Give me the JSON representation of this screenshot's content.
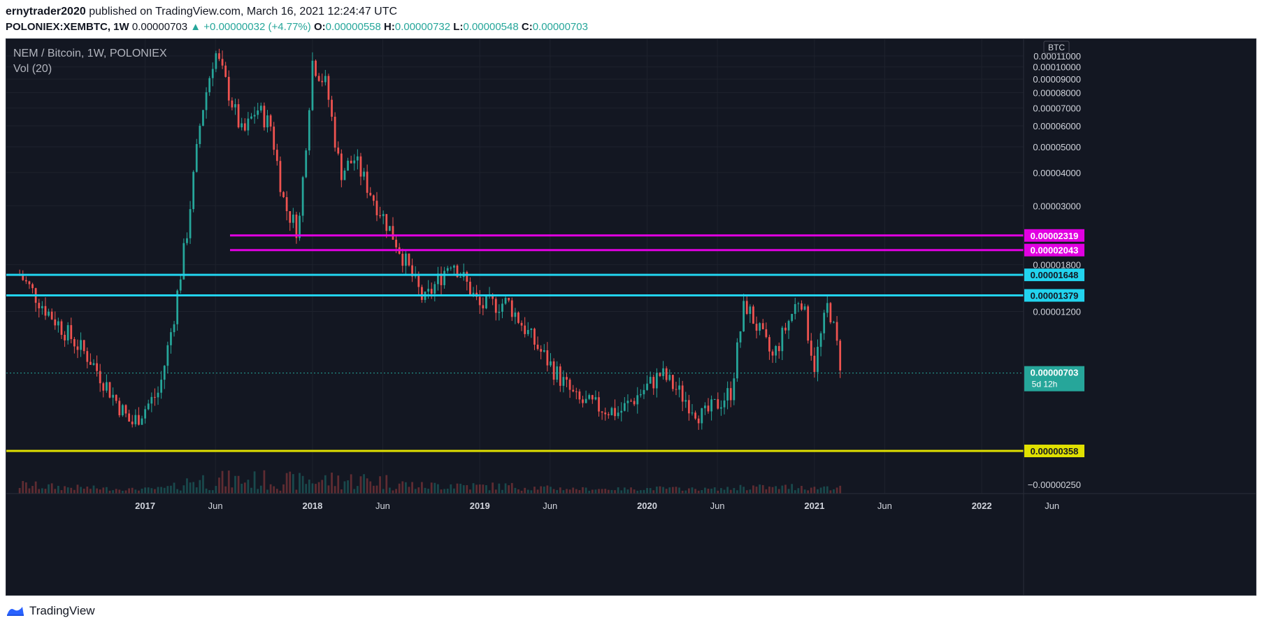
{
  "header": {
    "author": "ernytrader2020",
    "published": "published on TradingView.com, March 16, 2021 12:24:47 UTC"
  },
  "symbol_line": {
    "symbol": "POLONIEX:XEMBTC, 1W",
    "price": "0.00000703",
    "change": "▲ +0.00000032 (+4.77%)",
    "o_label": "O:",
    "o_value": "0.00000558",
    "h_label": "H:",
    "h_value": "0.00000732",
    "l_label": "L:",
    "l_value": "0.00000548",
    "c_label": "C:",
    "c_value": "0.00000703"
  },
  "legend": {
    "title": "NEM / Bitcoin, 1W, POLONIEX",
    "indicator": "Vol (20)"
  },
  "footer": {
    "brand": "TradingView",
    "logo_icon": "tradingview-logo-icon"
  },
  "colors": {
    "background": "#131722",
    "up": "#26a69a",
    "down": "#ef5350",
    "magenta": "#e100e1",
    "cyan": "#22d3ee",
    "yellow": "#e0e000",
    "grid": "#1e222d",
    "axis_text": "#d1d4dc"
  },
  "chart_data": {
    "type": "candlestick",
    "currency_badge": "BTC",
    "y_ticks": [
      "0.00011000",
      "0.00010000",
      "0.00009000",
      "0.00008000",
      "0.00007000",
      "0.00006000",
      "0.00005000",
      "0.00004000",
      "0.00003000",
      "0.00001800",
      "0.00001200",
      "−0.00000250"
    ],
    "x_ticks": [
      "2017",
      "Jun",
      "2018",
      "Jun",
      "2019",
      "Jun",
      "2020",
      "Jun",
      "2021",
      "Jun",
      "2022",
      "Jun"
    ],
    "horizontal_levels": [
      {
        "label": "0.00002319",
        "value": 2.319e-05,
        "color": "#e100e1"
      },
      {
        "label": "0.00002043",
        "value": 2.043e-05,
        "color": "#e100e1"
      },
      {
        "label": "0.00001648",
        "value": 1.648e-05,
        "color": "#22d3ee"
      },
      {
        "label": "0.00001379",
        "value": 1.379e-05,
        "color": "#22d3ee"
      },
      {
        "label": "0.00000358",
        "value": 3.58e-06,
        "color": "#e0e000"
      }
    ],
    "last_price": {
      "label": "0.00000703",
      "countdown": "5d 12h"
    },
    "price_path": [
      [
        "2016-04",
        1.65e-05
      ],
      [
        "2016-06",
        1.2e-05
      ],
      [
        "2016-09",
        8e-06
      ],
      [
        "2016-12",
        4.5e-06
      ],
      [
        "2017-02",
        6e-06
      ],
      [
        "2017-03",
        1.1e-05
      ],
      [
        "2017-04",
        2.4e-05
      ],
      [
        "2017-05",
        6.5e-05
      ],
      [
        "2017-06",
        0.000115
      ],
      [
        "2017-07",
        8e-05
      ],
      [
        "2017-08",
        5.5e-05
      ],
      [
        "2017-09",
        7e-05
      ],
      [
        "2017-10",
        6e-05
      ],
      [
        "2017-11",
        3e-05
      ],
      [
        "2017-12",
        2.4e-05
      ],
      [
        "2018-01",
        0.000105
      ],
      [
        "2018-02",
        8.5e-05
      ],
      [
        "2018-03",
        4e-05
      ],
      [
        "2018-04",
        4.5e-05
      ],
      [
        "2018-05",
        3.5e-05
      ],
      [
        "2018-07",
        2.2e-05
      ],
      [
        "2018-09",
        1.3e-05
      ],
      [
        "2018-11",
        1.9e-05
      ],
      [
        "2019-01",
        1.25e-05
      ],
      [
        "2019-03",
        1.3e-05
      ],
      [
        "2019-05",
        9e-06
      ],
      [
        "2019-08",
        5.5e-06
      ],
      [
        "2019-11",
        5e-06
      ],
      [
        "2020-02",
        7e-06
      ],
      [
        "2020-05",
        4.8e-06
      ],
      [
        "2020-07",
        6e-06
      ],
      [
        "2020-08",
        1.3e-05
      ],
      [
        "2020-10",
        8e-06
      ],
      [
        "2020-12",
        1.4e-05
      ],
      [
        "2021-01",
        7.5e-06
      ],
      [
        "2021-02",
        1.3e-05
      ],
      [
        "2021-03",
        7e-06
      ]
    ]
  }
}
